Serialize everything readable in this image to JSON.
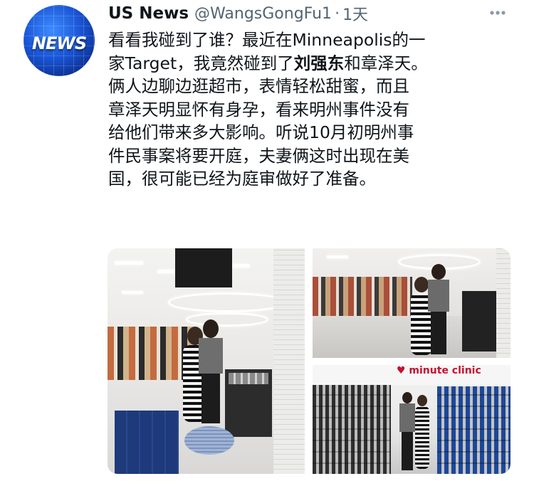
{
  "author": {
    "avatar_text": "NEWS",
    "display_name": "US News",
    "handle": "@WangsGongFu1",
    "separator": "·",
    "time": "1天"
  },
  "more_icon": "more-horizontal-icon",
  "tweet": {
    "lines": [
      {
        "text": "看看我碰到了谁？最近在Minneapolis的一"
      },
      {
        "pre": "家Target，我竟然碰到了",
        "bold": "刘强东",
        "post": "和章泽天。"
      },
      {
        "text": "俩人边聊边逛超市，表情轻松甜蜜，而且"
      },
      {
        "text": "章泽天明显怀有身孕，看来明州事件没有"
      },
      {
        "text": "给他们带来多大影响。听说10月初明州事"
      },
      {
        "text": "件民事案将要开庭，夫妻俩这时出现在美"
      },
      {
        "text": "国，很可能已经为庭审做好了准备。"
      }
    ]
  },
  "media": {
    "photo3_sign": "♥ minute clinic"
  },
  "colors": {
    "text": "#0f1419",
    "secondary": "#536471",
    "avatar_blue": "#1a55d6",
    "clinic_red": "#c8102e"
  }
}
